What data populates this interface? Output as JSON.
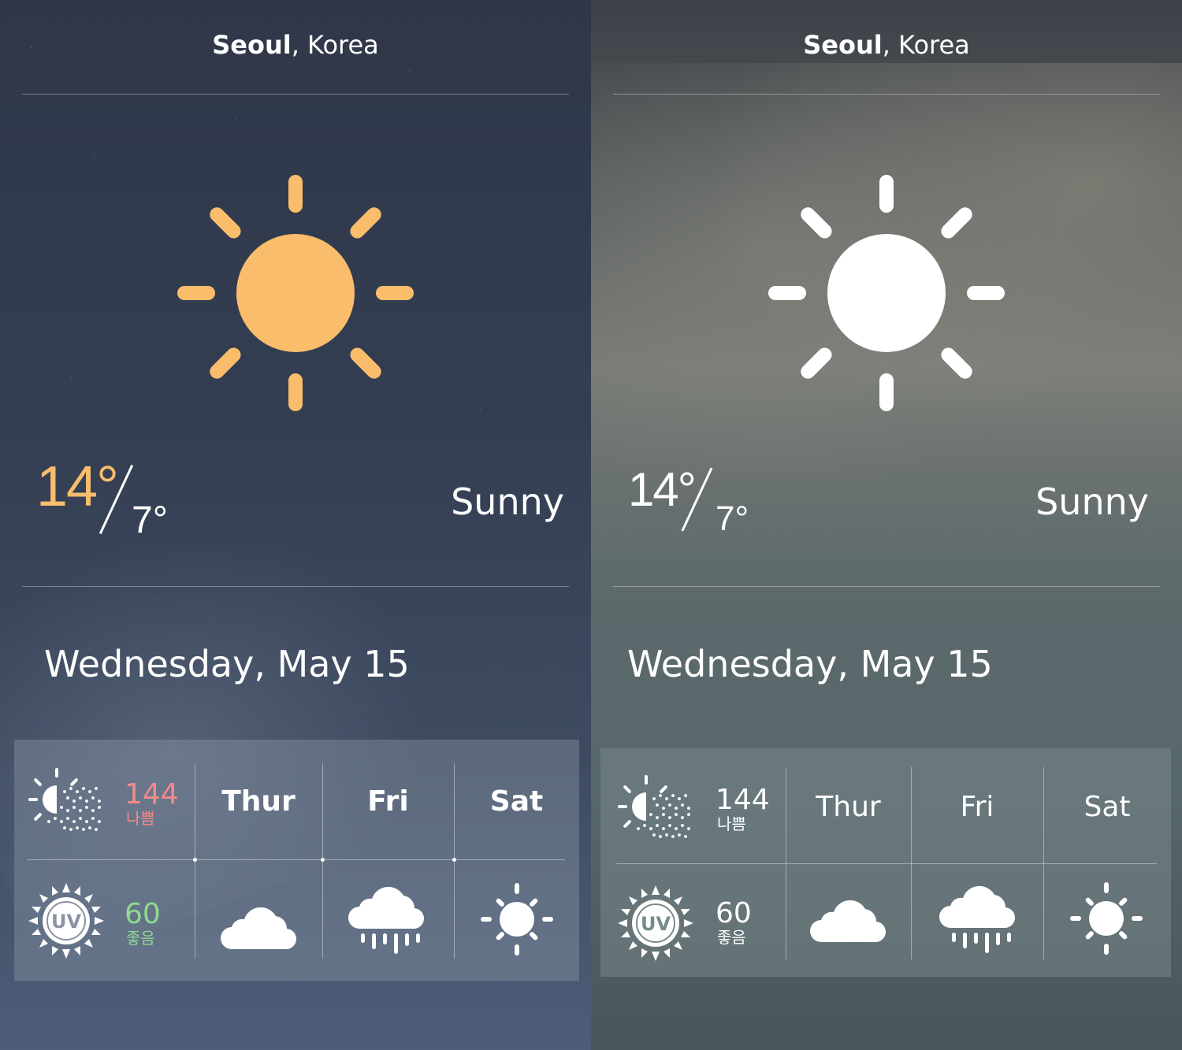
{
  "location": {
    "city": "Seoul",
    "separator": ", ",
    "country": "Korea"
  },
  "current": {
    "high": "14°",
    "low": "7°",
    "condition": "Sunny"
  },
  "date": "Wednesday, May 15",
  "air_quality": {
    "value": "144",
    "label": "나쁨"
  },
  "uv": {
    "value": "60",
    "label": "좋음",
    "icon_text": "UV"
  },
  "forecast": [
    {
      "day": "Thur",
      "icon": "cloud-icon"
    },
    {
      "day": "Fri",
      "icon": "rain-icon"
    },
    {
      "day": "Sat",
      "icon": "sun-icon"
    }
  ],
  "colors": {
    "sun_orange": "#f9bd6b",
    "aq_bad_red": "#f28a8a",
    "uv_good_green": "#8fd98f",
    "white": "#ffffff"
  }
}
